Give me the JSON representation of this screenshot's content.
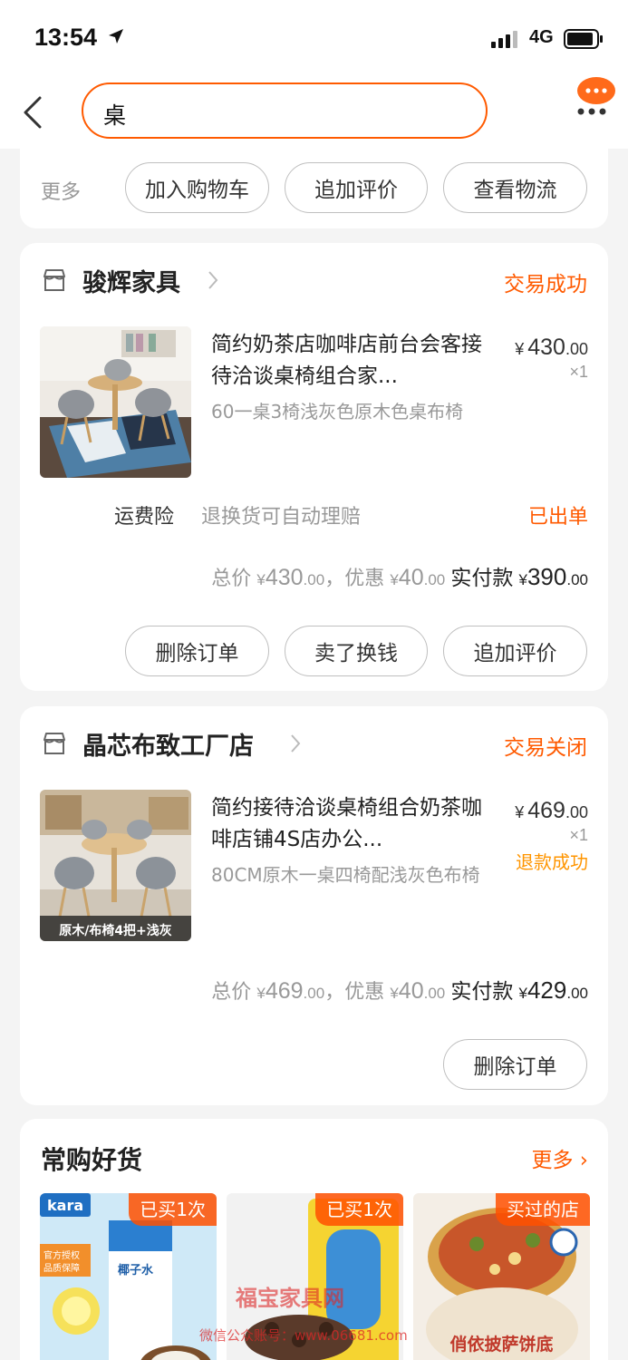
{
  "status_bar": {
    "time": "13:54",
    "network": "4G"
  },
  "search": {
    "query": "桌"
  },
  "top_card": {
    "more_label": "更多",
    "buttons": [
      "加入购物车",
      "追加评价",
      "查看物流"
    ]
  },
  "orders": [
    {
      "shop": "骏辉家具",
      "status": "交易成功",
      "title": "简约奶茶店咖啡店前台会客接待洽谈桌椅组合家...",
      "spec": "60一桌3椅浅灰色原木色桌布椅",
      "price_yen": "¥",
      "price_int": "430",
      "price_dec": ".00",
      "qty": "×1",
      "insurance_label": "运费险",
      "insurance_desc": "退换货可自动理赔",
      "insurance_status": "已出单",
      "totals": {
        "total_label": "总价",
        "total_int": "430",
        "total_dec": ".00",
        "discount_label": "，优惠",
        "discount_int": "40",
        "discount_dec": ".00",
        "paid_label": "实付款",
        "paid_int": "390",
        "paid_dec": ".00",
        "yen": "¥"
      },
      "buttons": [
        "删除订单",
        "卖了换钱",
        "追加评价"
      ]
    },
    {
      "shop": "晶芯布致工厂店",
      "status": "交易关闭",
      "title": "简约接待洽谈桌椅组合奶茶咖啡店铺4S店办公...",
      "spec": "80CM原木一桌四椅配浅灰色布椅",
      "thumb_caption": "原木/布椅4把+浅灰",
      "price_yen": "¥",
      "price_int": "469",
      "price_dec": ".00",
      "qty": "×1",
      "refund": "退款成功",
      "totals": {
        "total_label": "总价",
        "total_int": "469",
        "total_dec": ".00",
        "discount_label": "，优惠",
        "discount_int": "40",
        "discount_dec": ".00",
        "paid_label": "实付款",
        "paid_int": "429",
        "paid_dec": ".00",
        "yen": "¥"
      },
      "buttons": [
        "删除订单"
      ]
    }
  ],
  "recommend": {
    "title": "常购好货",
    "more": "更多",
    "products": [
      {
        "tag": "已买1次",
        "brand": "kara",
        "badge_1": "官方授权",
        "badge_2": "品质保障",
        "caption": "椰子水"
      },
      {
        "tag": "已买1次"
      },
      {
        "tag": "买过的店",
        "caption": "俏依披萨饼底"
      }
    ]
  },
  "watermark": {
    "line1": "福宝家具网",
    "line2": "微信公众账号：www.06681.com"
  },
  "colors": {
    "accent": "#ff5a00",
    "refund": "#ff9500",
    "background": "#f4f4f4"
  }
}
